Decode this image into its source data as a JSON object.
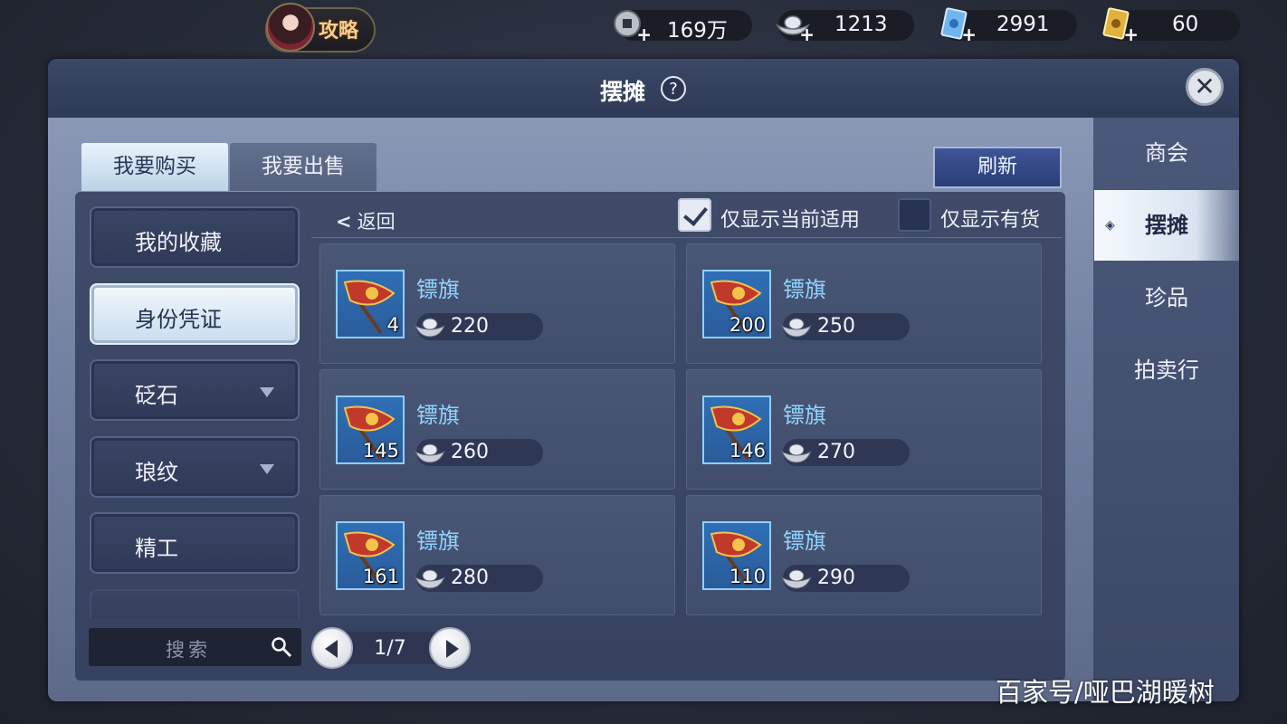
{
  "header": {
    "guide_label": "攻略",
    "currencies": [
      {
        "name": "copper-coins-icon",
        "value": "169万"
      },
      {
        "name": "silver-ingot-icon",
        "value": "1213"
      },
      {
        "name": "blue-ticket-icon",
        "value": "2991"
      },
      {
        "name": "gold-ticket-icon",
        "value": "60"
      }
    ]
  },
  "window": {
    "title": "摆摊",
    "help": "?",
    "close": "✕"
  },
  "tabs": [
    {
      "label": "我要购买",
      "active": true
    },
    {
      "label": "我要出售",
      "active": false
    }
  ],
  "refresh_label": "刷新",
  "categories": [
    {
      "label": "我的收藏",
      "active": false,
      "dropdown": false
    },
    {
      "label": "身份凭证",
      "active": true,
      "dropdown": false
    },
    {
      "label": "砭石",
      "active": false,
      "dropdown": true
    },
    {
      "label": "琅纹",
      "active": false,
      "dropdown": true
    },
    {
      "label": "精工",
      "active": false,
      "dropdown": false
    }
  ],
  "filters": {
    "back_label": "返回",
    "current_applicable": {
      "label": "仅显示当前适用",
      "checked": true
    },
    "in_stock": {
      "label": "仅显示有货",
      "checked": false
    }
  },
  "items": [
    {
      "name": "镖旗",
      "qty": "4",
      "price": "220"
    },
    {
      "name": "镖旗",
      "qty": "200",
      "price": "250"
    },
    {
      "name": "镖旗",
      "qty": "145",
      "price": "260"
    },
    {
      "name": "镖旗",
      "qty": "146",
      "price": "270"
    },
    {
      "name": "镖旗",
      "qty": "161",
      "price": "280"
    },
    {
      "name": "镖旗",
      "qty": "110",
      "price": "290"
    }
  ],
  "search": {
    "placeholder": "搜索"
  },
  "pager": {
    "text": "1/7"
  },
  "side_nav": [
    {
      "label": "商会",
      "active": false
    },
    {
      "label": "摆摊",
      "active": true
    },
    {
      "label": "珍品",
      "active": false
    },
    {
      "label": "拍卖行",
      "active": false
    }
  ],
  "watermark": "百家号/哑巴湖暖树",
  "colors": {
    "item_name": "#8fd5ff",
    "active_tab": "#e9f3fb",
    "refresh_button": "#3f5596",
    "item_icon_bg": "#2f6fb6"
  }
}
